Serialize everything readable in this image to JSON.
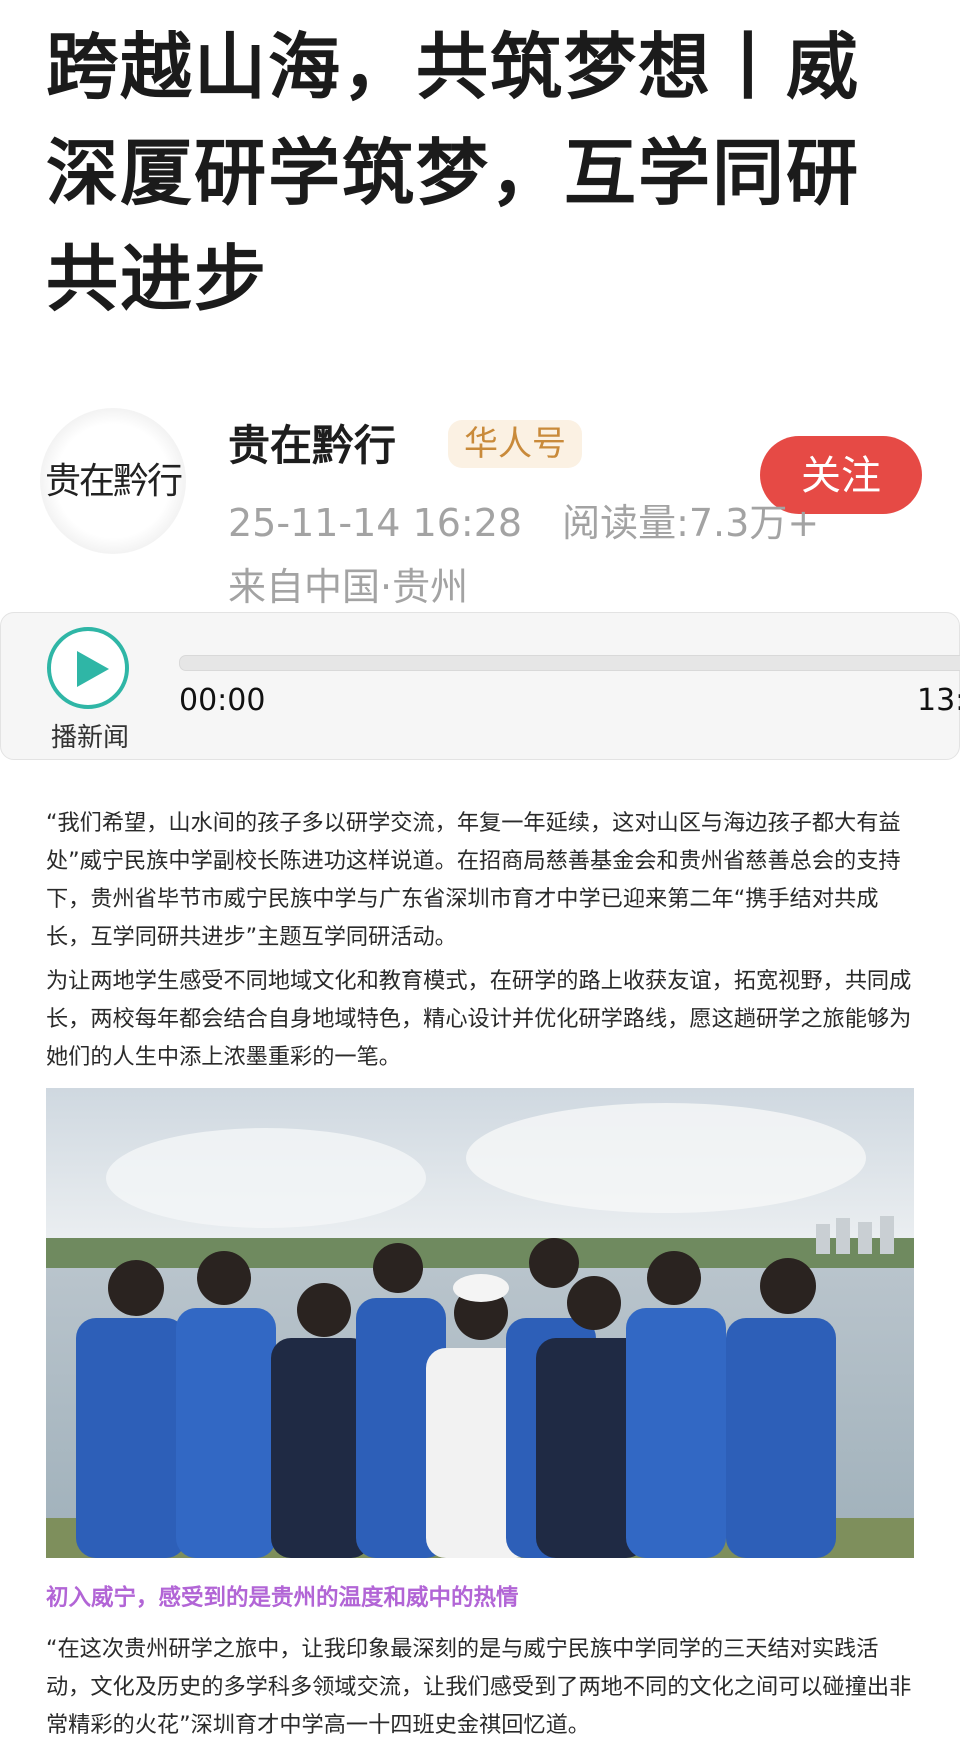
{
  "article": {
    "title": "跨越山海，共筑梦想丨威深厦研学筑梦，互学同研共进步"
  },
  "author": {
    "logo_text": "贵在黔行",
    "name": "贵在黔行",
    "badge": "华人号",
    "date": "25-11-14 16:28",
    "views": "阅读量:7.3万+",
    "location": "来自中国·贵州",
    "follow_label": "关注"
  },
  "player": {
    "label": "播新闻",
    "current_time": "00:00",
    "total_time": "13:",
    "progress": 0,
    "accent_color": "#2fb6a6"
  },
  "body": {
    "p1": "“我们希望，山水间的孩子多以研学交流，年复一年延续，这对山区与海边孩子都大有益处”威宁民族中学副校长陈进功这样说道。在招商局慈善基金会和贵州省慈善总会的支持下，贵州省毕节市威宁民族中学与广东省深圳市育才中学已迎来第二年“携手结对共成长，互学同研共进步”主题互学同研活动。",
    "p2": "为让两地学生感受不同地域文化和教育模式，在研学的路上收获友谊，拓宽视野，共同成长，两校每年都会结合自身地域特色，精心设计并优化研学路线，愿这趟研学之旅能够为她们的人生中添上浓墨重彩的一笔。",
    "subheading": "初入威宁，感受到的是贵州的温度和威中的热情",
    "p3": "“在这次贵州研学之旅中，让我印象最深刻的是与威宁民族中学同学的三天结对实践活动，文化及历史的多学科多领域交流，让我们感受到了两地不同的文化之间可以碰撞出非常精彩的火花”深圳育才中学高一十四班史金祺回忆道。"
  },
  "colors": {
    "follow_button": "#e64a45",
    "badge_bg": "#fbf1e3",
    "badge_text": "#c98a3a",
    "subheading": "#b265d6"
  }
}
